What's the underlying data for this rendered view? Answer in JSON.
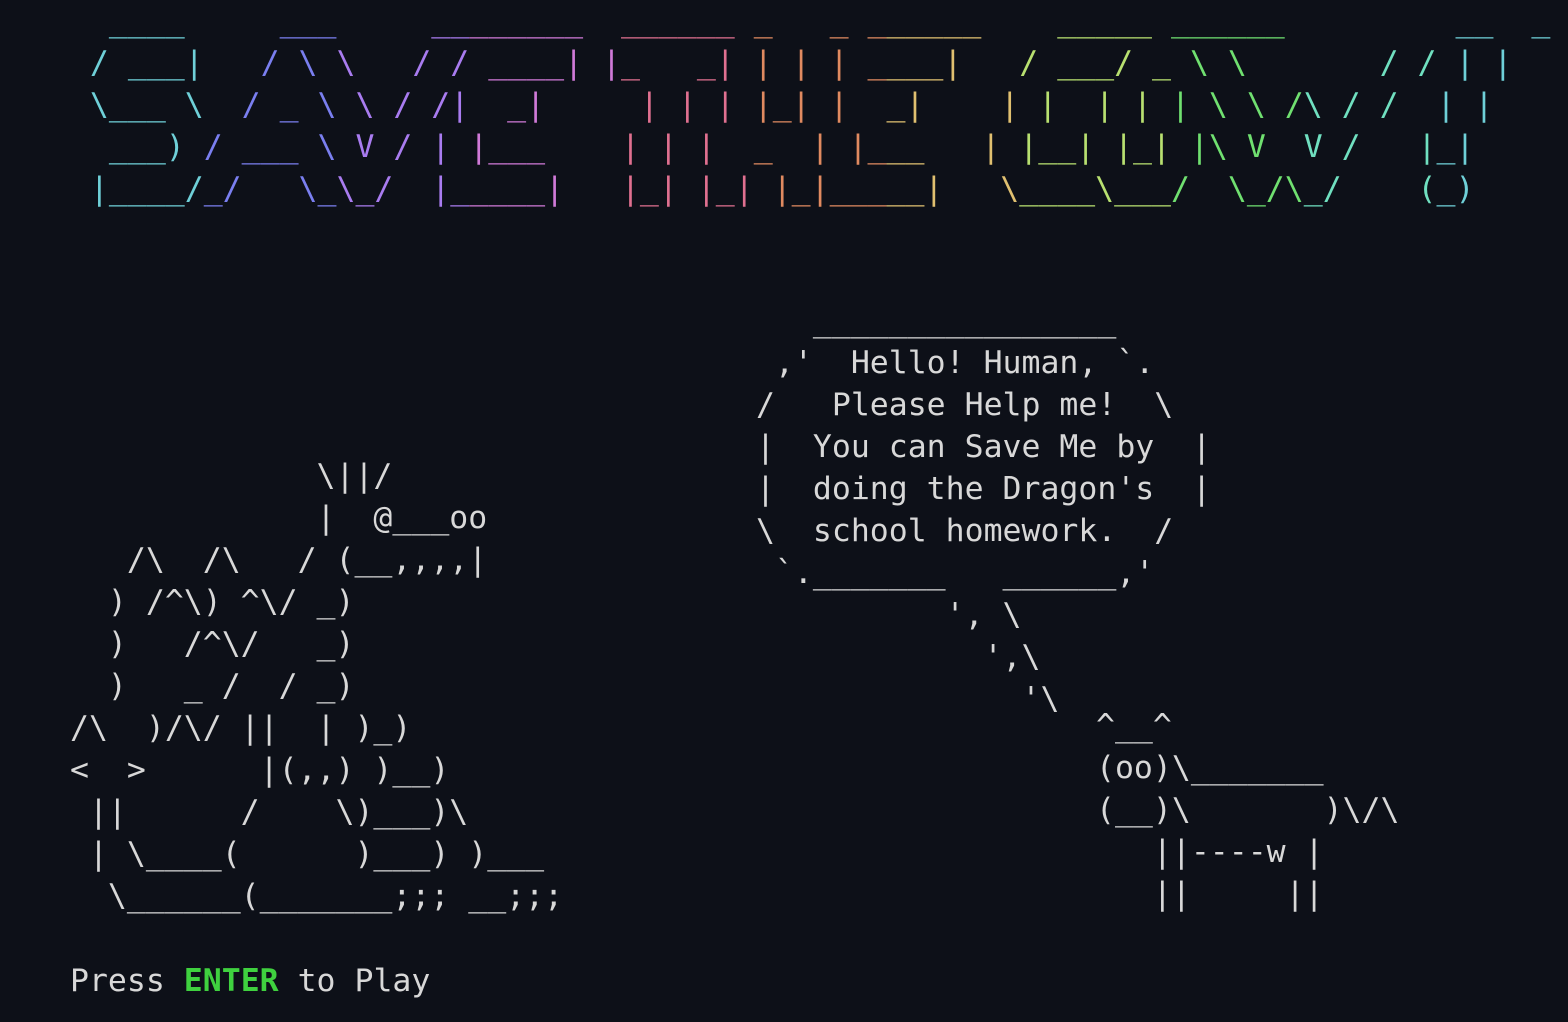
{
  "colors": {
    "background": "#0d1018",
    "text": "#d8d8d8",
    "enter_key": "#3fd13f",
    "banner_palette": [
      "#6fd0d8",
      "#7a7ff0",
      "#a97cf0",
      "#d07ad8",
      "#e07090",
      "#e08a60",
      "#e0c070",
      "#b8e070",
      "#70e070",
      "#70e0c0",
      "#6fd0d8"
    ]
  },
  "banner": {
    "lines": [
      "   ____     ___     ________  ______ _   _ ______    _____ ______         __  _ ",
      "  / ___|   / \\ \\   / / ____| |_   _| | | | ____|   / ___/ _ \\ \\       / / | |",
      "  \\___ \\  / _ \\ \\ / /|  _|     | | | |_| |  _|    | |  | | | \\ \\ /\\ / /  | |",
      "   ___) / ___ \\ V / | |___    | | |  _  | |___   | |__| |_| |\\ V  V /   |_|",
      "  |____/_/   \\_\\_/  |_____|   |_| |_| |_|_____|   \\____\\___/  \\_/\\_/    (_)"
    ]
  },
  "dragon": {
    "lines": [
      "             \\||/",
      "             |  @___oo",
      "   /\\  /\\   / (__,,,,|",
      "  ) /^\\) ^\\/ _)",
      "  )   /^\\/   _)",
      "  )   _ /  / _)",
      "/\\  )/\\/ ||  | )_)",
      "<  >      |(,,) )__)",
      " ||      /    \\)___)\\",
      " | \\____(      )___) )___",
      "  \\______(_______;;; __;;;"
    ]
  },
  "speech_bubble": {
    "lines": [
      "   ________________",
      " ,'  Hello! Human, `.",
      "/   Please Help me!  \\",
      "|  You can Save Me by  |",
      "|  doing the Dragon's  |",
      "\\  school homework.  /",
      " `._______   ______,'",
      "          ', \\",
      "            ',\\",
      "              '\\"
    ]
  },
  "cow": {
    "lines": [
      "^__^",
      "(oo)\\_______",
      "(__)\\       )\\/\\",
      "   ||----w |",
      "   ||     ||"
    ]
  },
  "prompt": {
    "before": "Press ",
    "key": "ENTER",
    "after": " to Play"
  }
}
